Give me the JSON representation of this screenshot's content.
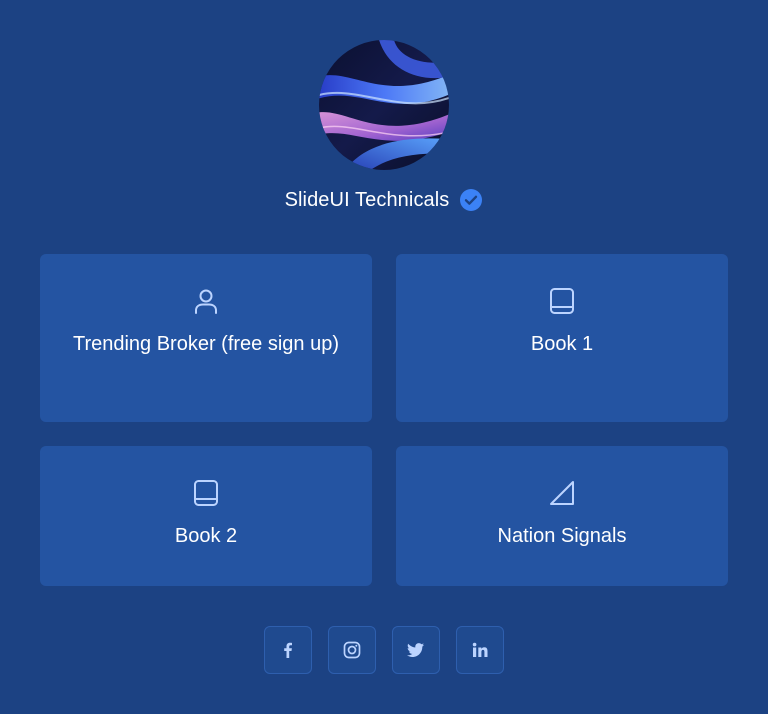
{
  "profile": {
    "name": "SlideUI Technicals",
    "verified": true,
    "avatar_icon": "abstract-ribbon-avatar"
  },
  "links": [
    {
      "label": "Trending Broker (free sign up)",
      "icon": "user-icon"
    },
    {
      "label": "Book 1",
      "icon": "book-icon"
    },
    {
      "label": "Book 2",
      "icon": "book-icon"
    },
    {
      "label": "Nation Signals",
      "icon": "triangle-icon"
    }
  ],
  "social": [
    {
      "network": "facebook",
      "icon": "facebook-icon"
    },
    {
      "network": "instagram",
      "icon": "instagram-icon"
    },
    {
      "network": "twitter",
      "icon": "twitter-icon"
    },
    {
      "network": "linkedin",
      "icon": "linkedin-icon"
    }
  ],
  "colors": {
    "background": "#1c4283",
    "card": "#2454a2",
    "icon": "#bcd4ff",
    "verified": "#3b82f6",
    "text": "#ffffff"
  }
}
